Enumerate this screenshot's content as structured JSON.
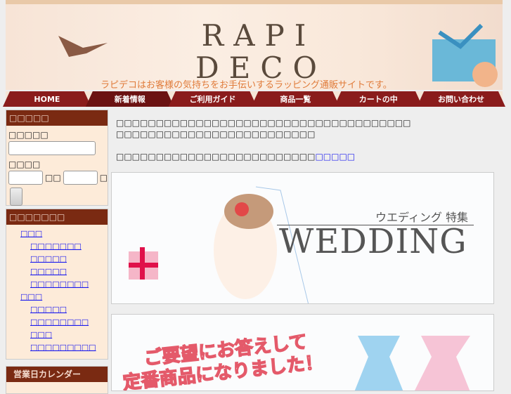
{
  "header": {
    "logo_line1": "RAPI",
    "logo_line2": "DECO",
    "tagline": "ラピデコはお客様の気持ちをお手伝いするラッピング通販サイトです。"
  },
  "nav": [
    {
      "label": "HOME"
    },
    {
      "label": "新着情報"
    },
    {
      "label": "ご利用ガイド"
    },
    {
      "label": "商品一覧"
    },
    {
      "label": "カートの中"
    },
    {
      "label": "お問い合わせ"
    }
  ],
  "search_box": {
    "title": "□□□□□",
    "keyword_label": "□□□□□",
    "keyword_value": "",
    "price_label": "□□□□",
    "price_sep": "□□",
    "price_suffix": "□",
    "submit_label": ""
  },
  "category_box": {
    "title": "□□□□□□□",
    "groups": [
      {
        "label": "□□□",
        "items": [
          "□□□□□□□",
          "□□□□□",
          "□□□□□",
          "□□□□□□□□"
        ]
      },
      {
        "label": "□□□",
        "items": [
          "□□□□□",
          "□□□□□□□□",
          "□□□",
          "□□□□□□□□□"
        ]
      }
    ]
  },
  "calendar_box": {
    "title": "営業日カレンダー"
  },
  "main": {
    "intro_line1": "□□□□□□□□□□□□□□□□□□□□□□□□□□□□□□□□□□□□□",
    "intro_line2": "□□□□□□□□□□□□□□□□□□□□□□□□□",
    "intro_line3": "□□□□□□□□□□□□□□□□□□□□□□□□□",
    "intro_link": "□□□□□"
  },
  "banner1": {
    "subtitle": "ウエディング 特集",
    "title": "WEDDING"
  },
  "banner2": {
    "title_line1": "ご要望にお答えして",
    "title_line2": "定番商品になりました！"
  }
}
